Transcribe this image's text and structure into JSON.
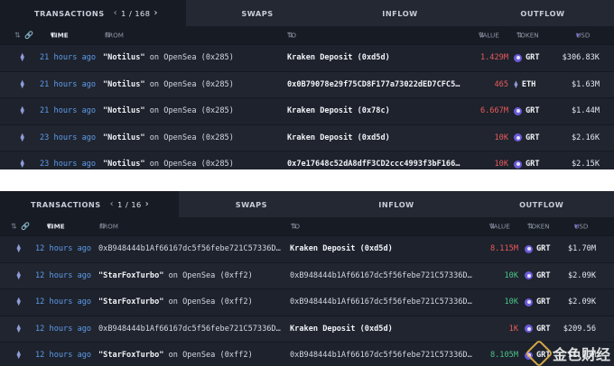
{
  "panels": [
    {
      "tabs": {
        "transactions": "TRANSACTIONS",
        "pager": "1 / 168",
        "swaps": "SWAPS",
        "inflow": "INFLOW",
        "outflow": "OUTFLOW"
      },
      "columns": {
        "time": "TIME",
        "from": "FROM",
        "to": "TO",
        "value": "VALUE",
        "token": "TOKEN",
        "usd": "USD"
      },
      "rows": [
        {
          "time": "21 hours ago",
          "from_q": "\"Notilus\"",
          "from_rest": " on OpenSea (0x285)",
          "to": "Kraken Deposit (0xd5d)",
          "to_bold": true,
          "value": "1.429M",
          "value_color": "red",
          "token": "GRT",
          "usd": "$306.83K"
        },
        {
          "time": "21 hours ago",
          "from_q": "\"Notilus\"",
          "from_rest": " on OpenSea (0x285)",
          "to": "0x0B79078e29f75CD8F177a73022dED7CFC5…",
          "to_bold": true,
          "value": "465",
          "value_color": "red",
          "token": "ETH",
          "usd": "$1.63M"
        },
        {
          "time": "21 hours ago",
          "from_q": "\"Notilus\"",
          "from_rest": " on OpenSea (0x285)",
          "to": "Kraken Deposit (0x78c)",
          "to_bold": true,
          "value": "6.667M",
          "value_color": "red",
          "token": "GRT",
          "usd": "$1.44M"
        },
        {
          "time": "23 hours ago",
          "from_q": "\"Notilus\"",
          "from_rest": " on OpenSea (0x285)",
          "to": "Kraken Deposit (0xd5d)",
          "to_bold": true,
          "value": "10K",
          "value_color": "red",
          "token": "GRT",
          "usd": "$2.16K"
        },
        {
          "time": "23 hours ago",
          "from_q": "\"Notilus\"",
          "from_rest": " on OpenSea (0x285)",
          "to": "0x7e17648c52dA8dfF3CD2ccc4993f3bF166…",
          "to_bold": true,
          "value": "10K",
          "value_color": "red",
          "token": "GRT",
          "usd": "$2.15K"
        }
      ]
    },
    {
      "tabs": {
        "transactions": "TRANSACTIONS",
        "pager": "1 / 16",
        "swaps": "SWAPS",
        "inflow": "INFLOW",
        "outflow": "OUTFLOW"
      },
      "columns": {
        "time": "TIME",
        "from": "FROM",
        "to": "TO",
        "value": "VALUE",
        "token": "TOKEN",
        "usd": "USD"
      },
      "rows": [
        {
          "time": "12 hours ago",
          "from_q": "",
          "from_rest": "0xB948444b1Af66167dc5f56febe721C57336D…",
          "to": "Kraken Deposit (0xd5d)",
          "to_bold": true,
          "value": "8.115M",
          "value_color": "red",
          "token": "GRT",
          "usd": "$1.70M"
        },
        {
          "time": "12 hours ago",
          "from_q": "\"StarFoxTurbo\"",
          "from_rest": " on OpenSea (0xff2)",
          "to": "0xB948444b1Af66167dc5f56febe721C57336D…",
          "to_bold": false,
          "value": "10K",
          "value_color": "green",
          "token": "GRT",
          "usd": "$2.09K"
        },
        {
          "time": "12 hours ago",
          "from_q": "\"StarFoxTurbo\"",
          "from_rest": " on OpenSea (0xff2)",
          "to": "0xB948444b1Af66167dc5f56febe721C57336D…",
          "to_bold": false,
          "value": "10K",
          "value_color": "green",
          "token": "GRT",
          "usd": "$2.09K"
        },
        {
          "time": "12 hours ago",
          "from_q": "",
          "from_rest": "0xB948444b1Af66167dc5f56febe721C57336D…",
          "to": "Kraken Deposit (0xd5d)",
          "to_bold": true,
          "value": "1K",
          "value_color": "red",
          "token": "GRT",
          "usd": "$209.56"
        },
        {
          "time": "12 hours ago",
          "from_q": "\"StarFoxTurbo\"",
          "from_rest": " on OpenSea (0xff2)",
          "to": "0xB948444b1Af66167dc5f56febe721C57336D…",
          "to_bold": false,
          "value": "8.105M",
          "value_color": "green",
          "token": "GRT",
          "usd": "$1.70M"
        }
      ]
    }
  ],
  "watermark": "金色财经"
}
